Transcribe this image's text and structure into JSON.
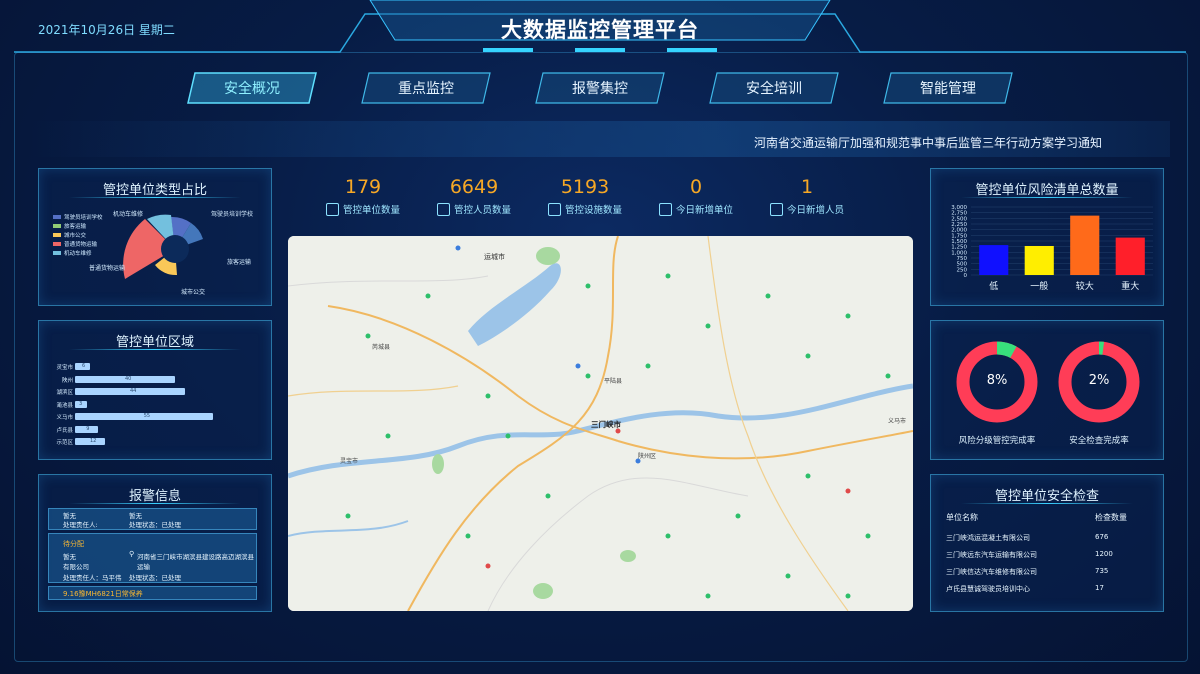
{
  "header": {
    "title": "大数据监控管理平台",
    "date": "2021年10月26日 星期二"
  },
  "nav": [
    {
      "label": "安全概况",
      "active": true
    },
    {
      "label": "重点监控",
      "active": false
    },
    {
      "label": "报警集控",
      "active": false
    },
    {
      "label": "安全培训",
      "active": false
    },
    {
      "label": "智能管理",
      "active": false
    }
  ],
  "notice": "河南省交通运输厅加强和规范事中事后监管三年行动方案学习通知",
  "stats": [
    {
      "value": "179",
      "label": "管控单位数量",
      "icon": "building-icon"
    },
    {
      "value": "6649",
      "label": "管控人员数量",
      "icon": "people-icon"
    },
    {
      "value": "5193",
      "label": "管控设施数量",
      "icon": "books-icon"
    },
    {
      "value": "0",
      "label": "今日新增单位",
      "icon": "doc-add-icon"
    },
    {
      "value": "1",
      "label": "今日新增人员",
      "icon": "id-card-icon"
    }
  ],
  "unit_type_panel": {
    "title": "管控单位类型占比",
    "legend": [
      {
        "name": "驾驶员培训学校",
        "color": "#5470c6"
      },
      {
        "name": "旅客运输",
        "color": "#91cc75"
      },
      {
        "name": "城市公交",
        "color": "#fac858"
      },
      {
        "name": "普通货物运输",
        "color": "#ee6666"
      },
      {
        "name": "机动车维修",
        "color": "#73c0de"
      }
    ],
    "labels": [
      "机动车维修",
      "驾驶员培训学校",
      "旅客运输",
      "普通货物运输",
      "城市公交"
    ]
  },
  "region_panel": {
    "title": "管控单位区域",
    "rows": [
      {
        "name": "灵宝市",
        "value": 6
      },
      {
        "name": "陕州",
        "value": 40
      },
      {
        "name": "湖滨区",
        "value": 44
      },
      {
        "name": "渑池县",
        "value": 3
      },
      {
        "name": "义马市",
        "value": 55
      },
      {
        "name": "卢氏县",
        "value": 9
      },
      {
        "name": "示范区",
        "value": 12
      }
    ]
  },
  "alarm_panel": {
    "title": "报警信息",
    "card1": {
      "l1": "暂无",
      "l2": "暂无",
      "l3": "处理责任人:",
      "l4": "处理状态：已处理"
    },
    "card2": {
      "head": "待分配",
      "l1": "暂无",
      "addr": "河南省三门峡市湖滨县建设路高迈湖滨县运输",
      "l2": "有限公司",
      "l3": "处理责任人：马平伟",
      "l4": "处理状态：已处理"
    },
    "card3": {
      "head": "9.16豫MH6821日常保养"
    }
  },
  "risk_panel": {
    "title": "管控单位风险清单总数量",
    "yticks": [
      "3,000",
      "2,750",
      "2,500",
      "2,250",
      "2,000",
      "1,750",
      "1,500",
      "1,250",
      "1,000",
      "750",
      "500",
      "250",
      "0"
    ]
  },
  "chart_data": {
    "type": "bar",
    "categories": [
      "低",
      "一般",
      "较大",
      "重大"
    ],
    "values": [
      1320,
      1280,
      2620,
      1650
    ],
    "colors": [
      "#1010ff",
      "#ffee00",
      "#ff6a1a",
      "#ff1f2a"
    ],
    "ylim": [
      0,
      3000
    ]
  },
  "rate_panel": {
    "donut1": {
      "value": "8%",
      "label": "风险分级管控完成率",
      "pct": 8
    },
    "donut2": {
      "value": "2%",
      "label": "安全检查完成率",
      "pct": 2
    }
  },
  "check_panel": {
    "title": "管控单位安全检查",
    "headers": [
      "单位名称",
      "检查数量"
    ],
    "rows": [
      {
        "name": "三门峡鸿运混凝土有限公司",
        "count": "676"
      },
      {
        "name": "三门峡远东汽车运输有限公司",
        "count": "1200"
      },
      {
        "name": "三门峡信达汽车维修有限公司",
        "count": "735"
      },
      {
        "name": "卢氏县慧诚驾驶员培训中心",
        "count": "17"
      }
    ]
  },
  "map": {
    "places": [
      "运城市",
      "三门峡市",
      "平陆县",
      "灵宝市",
      "芮城县",
      "陕州区",
      "义马市"
    ]
  }
}
